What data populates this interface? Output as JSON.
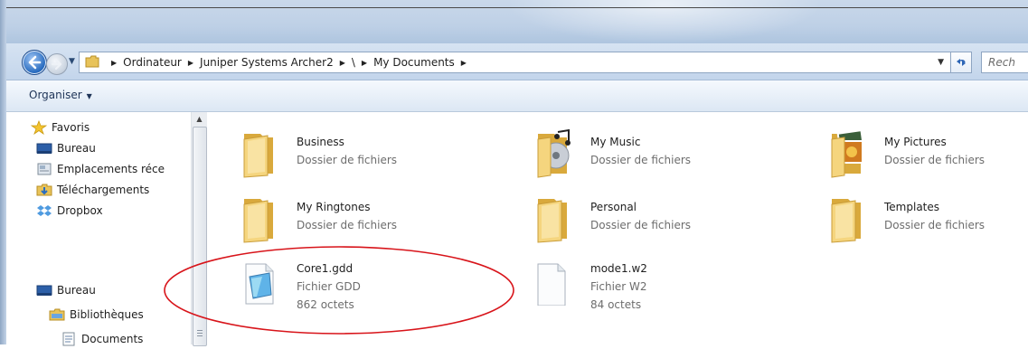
{
  "navigation": {
    "breadcrumbs": [
      "Ordinateur",
      "Juniper Systems Archer2",
      "\\",
      "My Documents"
    ],
    "search_placeholder": "Rech"
  },
  "toolbar": {
    "organise_label": "Organiser"
  },
  "sidebar": {
    "favorites_header": "Favoris",
    "favorites": [
      {
        "label": "Bureau",
        "icon": "desktop-icon"
      },
      {
        "label": "Emplacements réce",
        "icon": "recent-places-icon"
      },
      {
        "label": "Téléchargements",
        "icon": "downloads-icon"
      },
      {
        "label": "Dropbox",
        "icon": "dropbox-icon"
      }
    ],
    "tree": [
      {
        "label": "Bureau",
        "icon": "desktop-icon"
      },
      {
        "label": "Bibliothèques",
        "icon": "libraries-icon"
      },
      {
        "label": "Documents",
        "icon": "documents-icon"
      }
    ]
  },
  "files": [
    {
      "name": "Business",
      "type": "Dossier de fichiers",
      "icon": "folder-icon"
    },
    {
      "name": "My Music",
      "type": "Dossier de fichiers",
      "icon": "music-folder-icon"
    },
    {
      "name": "My Pictures",
      "type": "Dossier de fichiers",
      "icon": "pictures-folder-icon"
    },
    {
      "name": "My Ringtones",
      "type": "Dossier de fichiers",
      "icon": "folder-icon"
    },
    {
      "name": "Personal",
      "type": "Dossier de fichiers",
      "icon": "folder-icon"
    },
    {
      "name": "Templates",
      "type": "Dossier de fichiers",
      "icon": "folder-icon"
    },
    {
      "name": "Core1.gdd",
      "type": "Fichier GDD",
      "size": "862 octets",
      "icon": "gdd-file-icon"
    },
    {
      "name": "mode1.w2",
      "type": "Fichier W2",
      "size": "84 octets",
      "icon": "blank-file-icon"
    }
  ],
  "colors": {
    "annotation": "#d8141a",
    "accent": "#2a6dc0"
  }
}
